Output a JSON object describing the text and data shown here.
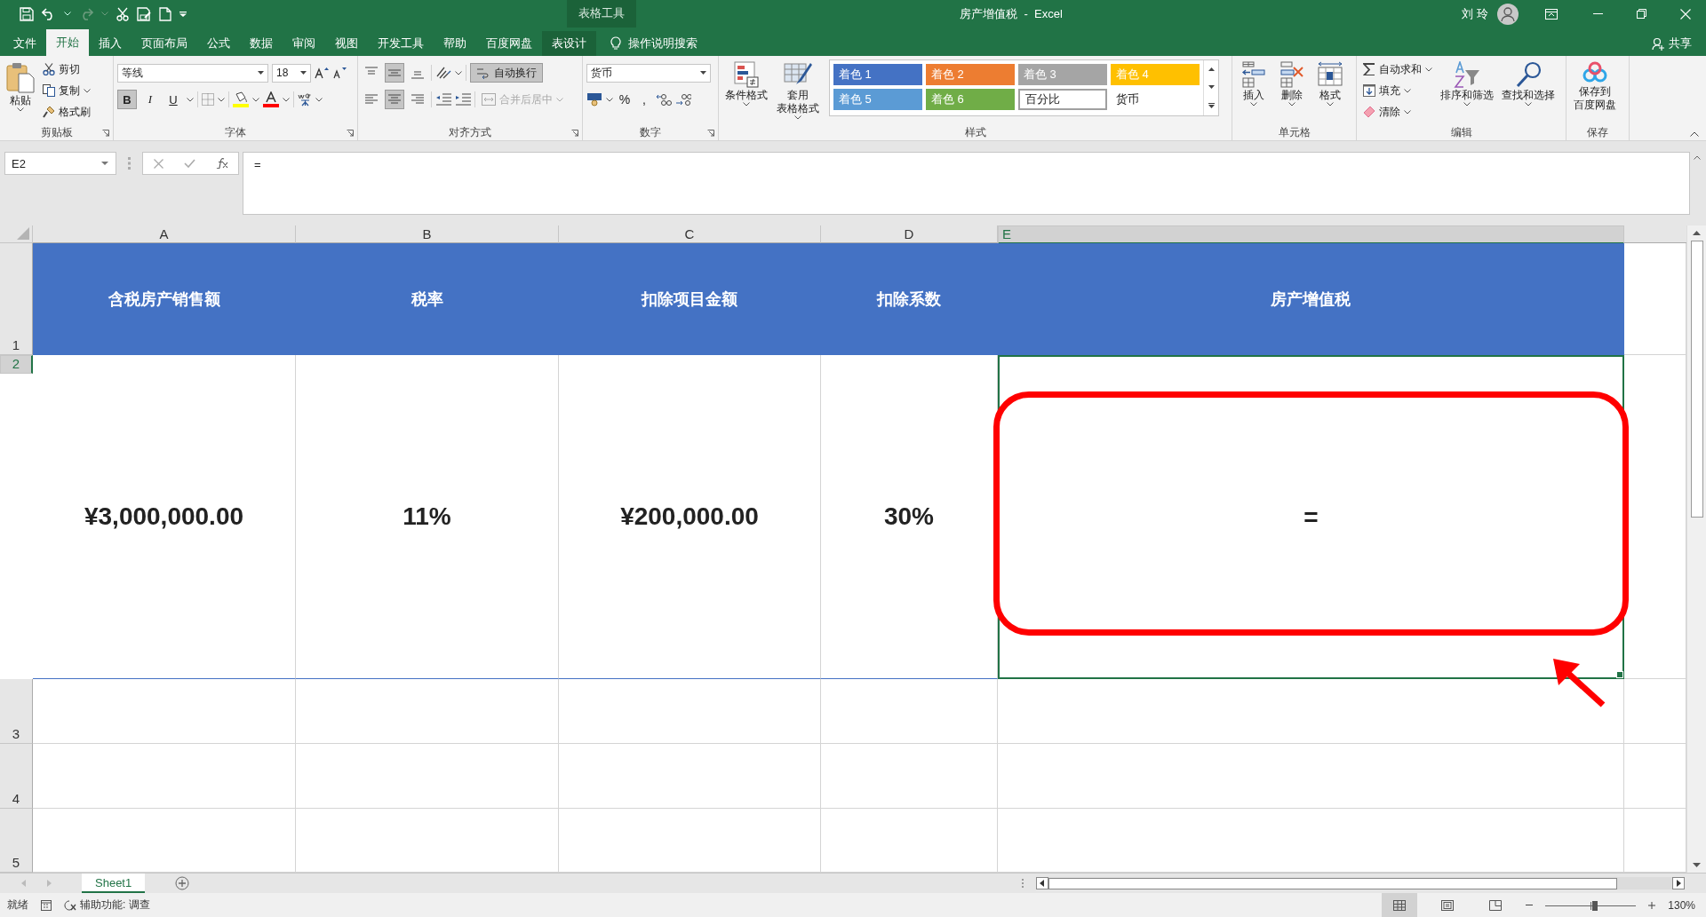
{
  "title_bar": {
    "context_label": "表格工具",
    "title": "房产增值税  -  Excel",
    "user": "刘 玲"
  },
  "ribbon_tabs": [
    {
      "label": "文件",
      "selected": false,
      "kind": "normal"
    },
    {
      "label": "开始",
      "selected": true,
      "kind": "normal"
    },
    {
      "label": "插入",
      "selected": false,
      "kind": "normal"
    },
    {
      "label": "页面布局",
      "selected": false,
      "kind": "normal"
    },
    {
      "label": "公式",
      "selected": false,
      "kind": "normal"
    },
    {
      "label": "数据",
      "selected": false,
      "kind": "normal"
    },
    {
      "label": "审阅",
      "selected": false,
      "kind": "normal"
    },
    {
      "label": "视图",
      "selected": false,
      "kind": "normal"
    },
    {
      "label": "开发工具",
      "selected": false,
      "kind": "normal"
    },
    {
      "label": "帮助",
      "selected": false,
      "kind": "normal"
    },
    {
      "label": "百度网盘",
      "selected": false,
      "kind": "normal"
    },
    {
      "label": "表设计",
      "selected": false,
      "kind": "context"
    }
  ],
  "tell_me": "操作说明搜索",
  "share": "共享",
  "clipboard": {
    "label": "剪贴板",
    "paste": "粘贴",
    "cut": "剪切",
    "copy": "复制",
    "format_painter": "格式刷"
  },
  "font": {
    "label": "字体",
    "font_name": "等线",
    "font_size": "18",
    "styles": [
      {
        "label": "B",
        "pressed": true
      },
      {
        "label": "I",
        "pressed": false
      },
      {
        "label": "U",
        "pressed": false
      }
    ]
  },
  "alignment": {
    "label": "对齐方式",
    "vertical": [
      {
        "kind": "top",
        "pressed": false
      },
      {
        "kind": "middle",
        "pressed": true
      },
      {
        "kind": "bottom",
        "pressed": false
      }
    ],
    "horizontal": [
      {
        "kind": "left",
        "pressed": false
      },
      {
        "kind": "center",
        "pressed": true
      },
      {
        "kind": "right",
        "pressed": false
      }
    ],
    "wrap_text": {
      "label": "自动换行",
      "pressed": true
    },
    "merge_center": {
      "label": "合并后居中",
      "disabled": true
    }
  },
  "number": {
    "label": "数字",
    "format": "货币",
    "symbols": [
      "%",
      ","
    ]
  },
  "styles": {
    "label": "样式",
    "conditional": "条件格式",
    "format_table": [
      "套用",
      "表格格式"
    ],
    "cell_styles": [
      {
        "label": "着色 1",
        "kind": "filled",
        "color": "#4472c4"
      },
      {
        "label": "着色 2",
        "kind": "filled",
        "color": "#ed7d31"
      },
      {
        "label": "着色 3",
        "kind": "filled",
        "color": "#a5a5a5"
      },
      {
        "label": "着色 4",
        "kind": "filled",
        "color": "#ffc000"
      },
      {
        "label": "着色 5",
        "kind": "filled",
        "color": "#5b9bd5"
      },
      {
        "label": "着色 6",
        "kind": "filled",
        "color": "#70ad47"
      },
      {
        "label": "百分比",
        "kind": "boxed"
      },
      {
        "label": "货币",
        "kind": "plain"
      }
    ]
  },
  "cells": {
    "label": "单元格",
    "buttons": [
      {
        "kind": "insert",
        "label": "插入"
      },
      {
        "kind": "delete",
        "label": "删除"
      },
      {
        "kind": "format",
        "label": "格式"
      }
    ]
  },
  "editing": {
    "label": "编辑",
    "small": [
      {
        "kind": "sum",
        "label": "自动求和"
      },
      {
        "kind": "fill",
        "label": "填充"
      },
      {
        "kind": "clear",
        "label": "清除"
      }
    ],
    "big": [
      {
        "kind": "sort",
        "label": "排序和筛选"
      },
      {
        "kind": "find",
        "label": "查找和选择"
      }
    ]
  },
  "save": {
    "label": "保存",
    "button": [
      "保存到",
      "百度网盘"
    ]
  },
  "formula_bar": {
    "name_box": "E2",
    "formula": "="
  },
  "grid": {
    "columns": [
      {
        "label": "A",
        "selected": false
      },
      {
        "label": "B",
        "selected": false
      },
      {
        "label": "C",
        "selected": false
      },
      {
        "label": "D",
        "selected": false
      },
      {
        "label": "E",
        "selected": true
      }
    ],
    "rows": [
      {
        "label": "1",
        "selected": false,
        "kind": "header",
        "cells": [
          {
            "text": "含税房产销售额",
            "active": false
          },
          {
            "text": "税率",
            "active": false
          },
          {
            "text": "扣除项目金额",
            "active": false
          },
          {
            "text": "扣除系数",
            "active": false
          },
          {
            "text": "房产增值税",
            "active": false
          }
        ]
      },
      {
        "label": "2",
        "selected": true,
        "kind": "value",
        "cells": [
          {
            "text": "¥3,000,000.00",
            "active": false
          },
          {
            "text": "11%",
            "active": false
          },
          {
            "text": "¥200,000.00",
            "active": false
          },
          {
            "text": "30%",
            "active": false
          },
          {
            "text": "=",
            "active": true
          }
        ]
      },
      {
        "label": "3",
        "selected": false,
        "kind": "empty"
      },
      {
        "label": "4",
        "selected": false,
        "kind": "empty"
      },
      {
        "label": "5",
        "selected": false,
        "kind": "empty"
      }
    ]
  },
  "sheet_tabs": [
    {
      "label": "Sheet1",
      "selected": true
    }
  ],
  "status_bar": {
    "ready": "就绪",
    "accessibility": "辅助功能: 调查",
    "views": [
      {
        "kind": "normal",
        "selected": true
      },
      {
        "kind": "page_layout",
        "selected": false
      },
      {
        "kind": "page_break",
        "selected": false
      }
    ],
    "zoom": {
      "level": 0.55,
      "reading": "130%"
    }
  },
  "annotations": {
    "highlight_box": true,
    "arrow": true
  }
}
